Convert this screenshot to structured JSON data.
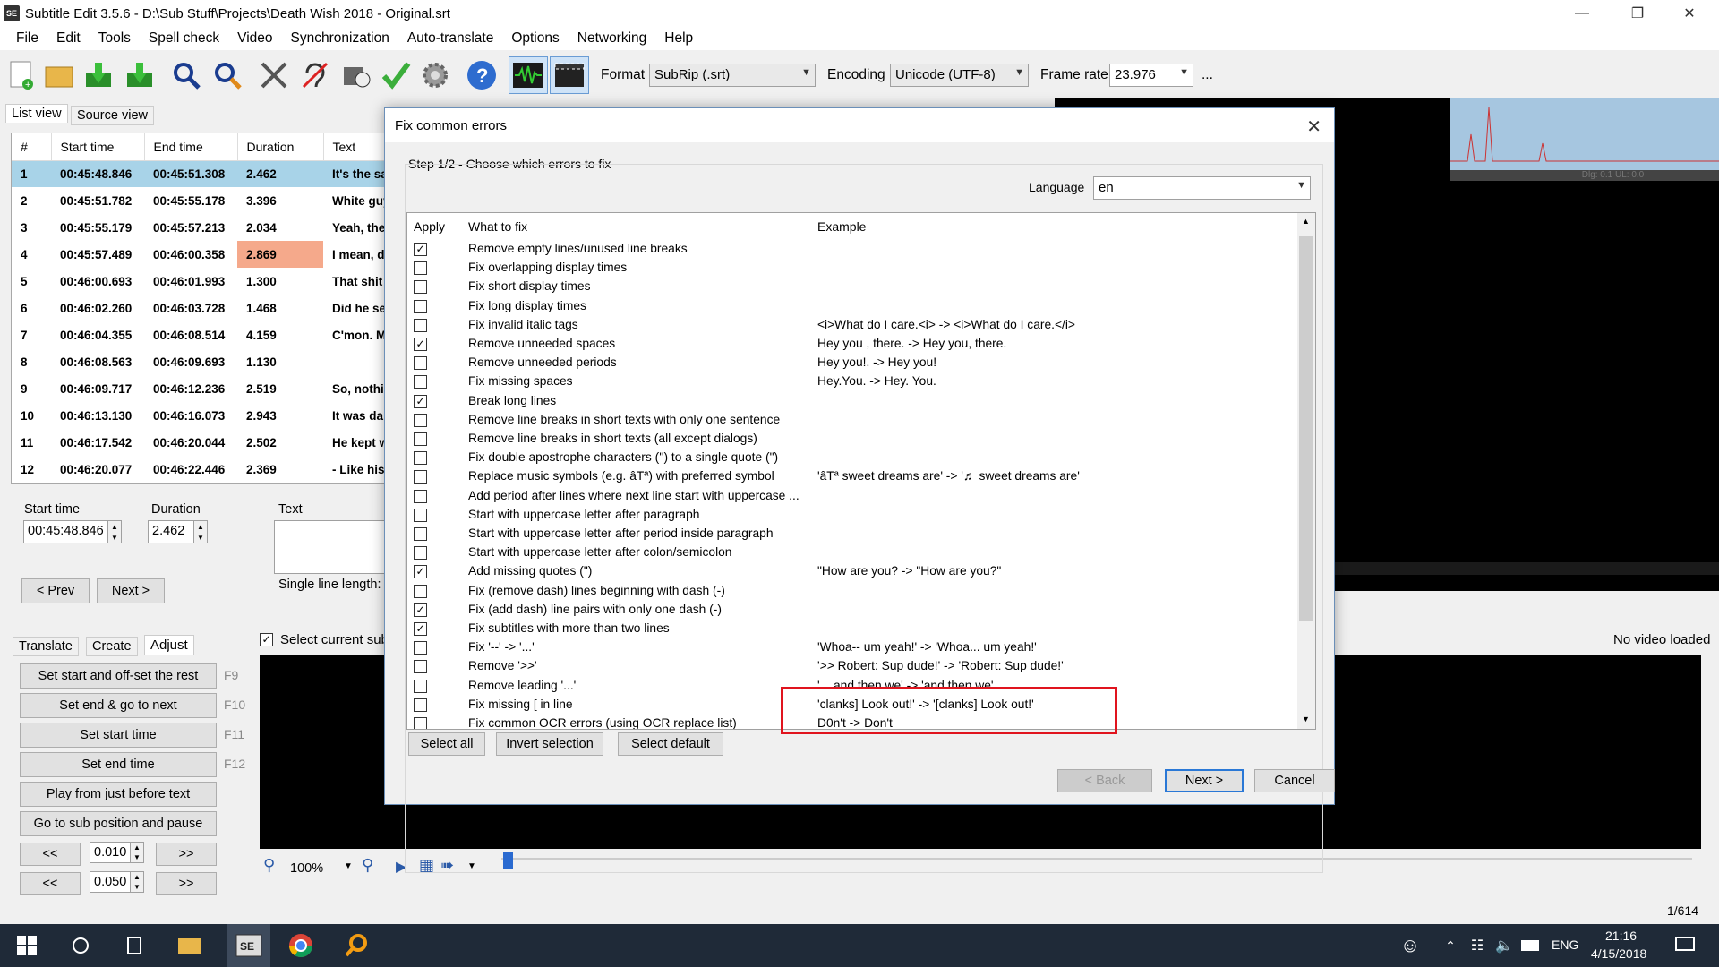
{
  "window": {
    "title": "Subtitle Edit 3.5.6 - D:\\Sub Stuff\\Projects\\Death Wish 2018 - Original.srt",
    "app_icon_text": "SE"
  },
  "menu": [
    "File",
    "Edit",
    "Tools",
    "Spell check",
    "Video",
    "Synchronization",
    "Auto-translate",
    "Options",
    "Networking",
    "Help"
  ],
  "toolbar": {
    "format_label": "Format",
    "format_value": "SubRip (.srt)",
    "encoding_label": "Encoding",
    "encoding_value": "Unicode (UTF-8)",
    "framerate_label": "Frame rate",
    "framerate_value": "23.976",
    "more": "..."
  },
  "view_tabs": [
    "List view",
    "Source view"
  ],
  "grid": {
    "columns": [
      "#",
      "Start time",
      "End time",
      "Duration",
      "Text"
    ],
    "rows": [
      [
        "1",
        "00:45:48.846",
        "00:45:51.308",
        "2.462",
        "It's the sa"
      ],
      [
        "2",
        "00:45:51.782",
        "00:45:55.178",
        "3.396",
        "White guy"
      ],
      [
        "3",
        "00:45:55.179",
        "00:45:57.213",
        "2.034",
        "Yeah, the"
      ],
      [
        "4",
        "00:45:57.489",
        "00:46:00.358",
        "2.869",
        "I mean, d"
      ],
      [
        "5",
        "00:46:00.693",
        "00:46:01.993",
        "1.300",
        "That shit"
      ],
      [
        "6",
        "00:46:02.260",
        "00:46:03.728",
        "1.468",
        "Did he se"
      ],
      [
        "7",
        "00:46:04.355",
        "00:46:08.514",
        "4.159",
        "C'mon. M"
      ],
      [
        "8",
        "00:46:08.563",
        "00:46:09.693",
        "1.130",
        ""
      ],
      [
        "9",
        "00:46:09.717",
        "00:46:12.236",
        "2.519",
        "So, nothi"
      ],
      [
        "10",
        "00:46:13.130",
        "00:46:16.073",
        "2.943",
        "It was da"
      ],
      [
        "11",
        "00:46:17.542",
        "00:46:20.044",
        "2.502",
        "He kept w"
      ],
      [
        "12",
        "00:46:20.077",
        "00:46:22.446",
        "2.369",
        "- Like his"
      ]
    ]
  },
  "editor": {
    "start_time_label": "Start time",
    "start_time_value": "00:45:48.846",
    "duration_label": "Duration",
    "duration_value": "2.462",
    "text_label": "Text",
    "single_line_label": "Single line length:",
    "prev_label": "< Prev",
    "next_label": "Next >"
  },
  "bottom_tabs": [
    "Translate",
    "Create",
    "Adjust"
  ],
  "select_current_label": "Select current sub",
  "adjust": {
    "buttons": [
      {
        "label": "Set start and off-set the rest",
        "key": "F9"
      },
      {
        "label": "Set end & go to next",
        "key": "F10"
      },
      {
        "label": "Set start time",
        "key": "F11"
      },
      {
        "label": "Set end time",
        "key": "F12"
      },
      {
        "label": "Play from just before text",
        "key": ""
      },
      {
        "label": "Go to sub position and pause",
        "key": ""
      }
    ],
    "step1_value": "0.010",
    "step2_value": "0.050",
    "back_label": "<<",
    "fwd_label": ">>"
  },
  "video": {
    "no_video": "No video loaded",
    "waveform_label": "Dlg: 0.1 UL: 0.0"
  },
  "waveform_toolbar": {
    "zoom": "100%"
  },
  "status": {
    "counter": "1/614"
  },
  "dialog": {
    "title": "Fix common errors",
    "step": "Step 1/2 - Choose which errors to fix",
    "language_label": "Language",
    "language_value": "en",
    "list_headers": [
      "Apply",
      "What to fix",
      "Example"
    ],
    "items": [
      {
        "checked": true,
        "what": "Remove empty lines/unused line breaks",
        "example": ""
      },
      {
        "checked": false,
        "what": "Fix overlapping display times",
        "example": ""
      },
      {
        "checked": false,
        "what": "Fix short display times",
        "example": ""
      },
      {
        "checked": false,
        "what": "Fix long display times",
        "example": ""
      },
      {
        "checked": false,
        "what": "Fix invalid italic tags",
        "example": "<i>What do I care.<i> -> <i>What do I care.</i>"
      },
      {
        "checked": true,
        "what": "Remove unneeded spaces",
        "example": "Hey   you , there. -> Hey you, there."
      },
      {
        "checked": false,
        "what": "Remove unneeded periods",
        "example": "Hey you!. -> Hey you!"
      },
      {
        "checked": false,
        "what": "Fix missing spaces",
        "example": "Hey.You. -> Hey. You."
      },
      {
        "checked": true,
        "what": "Break long lines",
        "example": ""
      },
      {
        "checked": false,
        "what": "Remove line breaks in short texts with only one sentence",
        "example": ""
      },
      {
        "checked": false,
        "what": "Remove line breaks in short texts (all except dialogs)",
        "example": ""
      },
      {
        "checked": false,
        "what": "Fix double apostrophe characters ('') to a single quote (\")",
        "example": ""
      },
      {
        "checked": false,
        "what": "Replace music symbols (e.g. âTª) with preferred symbol",
        "example": "'âTª sweet dreams are' -> '♬ sweet dreams are'"
      },
      {
        "checked": false,
        "what": "Add period after lines where next line start with uppercase ...",
        "example": ""
      },
      {
        "checked": false,
        "what": "Start with uppercase letter after paragraph",
        "example": ""
      },
      {
        "checked": false,
        "what": "Start with uppercase letter after period inside paragraph",
        "example": ""
      },
      {
        "checked": false,
        "what": "Start with uppercase letter after colon/semicolon",
        "example": ""
      },
      {
        "checked": true,
        "what": "Add missing quotes (\")",
        "example": "\"How are you? -> \"How are you?\""
      },
      {
        "checked": false,
        "what": "Fix (remove dash) lines beginning with dash (-)",
        "example": ""
      },
      {
        "checked": true,
        "what": "Fix (add dash) line pairs with only one dash (-)",
        "example": ""
      },
      {
        "checked": true,
        "what": "Fix subtitles with more than two lines",
        "example": ""
      },
      {
        "checked": false,
        "what": "Fix '--' -> '...'",
        "example": "'Whoa-- um yeah!' -> 'Whoa... um yeah!'"
      },
      {
        "checked": false,
        "what": "Remove '>>'",
        "example": "'>> Robert: Sup dude!' -> 'Robert: Sup dude!'"
      },
      {
        "checked": false,
        "what": "Remove leading '...'",
        "example": "'... and then we' -> 'and then we'"
      },
      {
        "checked": false,
        "what": "Fix missing [ in line",
        "example": "'clanks] Look out!' -> '[clanks] Look out!'"
      },
      {
        "checked": false,
        "what": "Fix common OCR errors (using OCR replace list)",
        "example": "D0n't -> Don't"
      }
    ],
    "select_all": "Select all",
    "invert_selection": "Invert selection",
    "select_default": "Select default",
    "back": "< Back",
    "next": "Next >",
    "cancel": "Cancel"
  },
  "taskbar": {
    "lang": "ENG",
    "time": "21:16",
    "date": "4/15/2018"
  }
}
